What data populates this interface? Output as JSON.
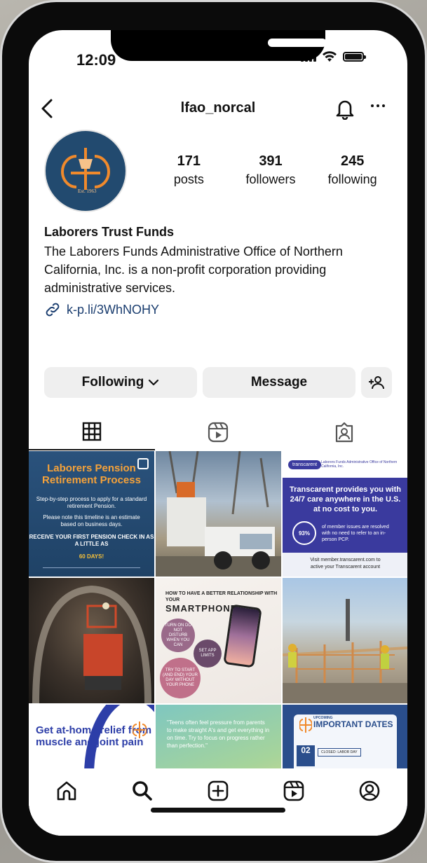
{
  "status_bar": {
    "time": "12:09"
  },
  "header": {
    "username": "lfao_norcal"
  },
  "profile": {
    "avatar_est": "Est. 1963",
    "stats": [
      {
        "value": "171",
        "label": "posts"
      },
      {
        "value": "391",
        "label": "followers"
      },
      {
        "value": "245",
        "label": "following"
      }
    ],
    "name": "Laborers Trust Funds",
    "bio": "The Laborers Funds Administrative Office of Northern California, Inc. is a non-profit corporation providing administrative services.",
    "link": "k-p.li/3WhNOHY"
  },
  "actions": {
    "following_label": "Following",
    "message_label": "Message"
  },
  "tabs": [
    "posts-grid",
    "reels",
    "tagged"
  ],
  "posts": {
    "p1": {
      "title": "Laborers Pension Retirement Process",
      "line1": "Step-by-step process to apply for a standard retirement Pension.",
      "line2": "Please note this timeline is an estimate based on business days.",
      "line3": "RECEIVE YOUR FIRST PENSION CHECK IN AS A LITTLE AS",
      "line3b": "60 DAYS!"
    },
    "p3": {
      "pill": "transcarent",
      "logo": "Laborers Funds Administrative Office of Northern California, Inc.",
      "headline": "Transcarent provides you with 24/7 care anywhere in the U.S. at no cost to you.",
      "percent": "93%",
      "stat_text": "of member issues are resolved with no need to refer to an in-person PCP.",
      "footer1": "Visit member.transcarent.com to",
      "footer2": "active your Transcarent account"
    },
    "p5": {
      "h1": "HOW TO HAVE A BETTER RELATIONSHIP WITH YOUR",
      "h2": "SMARTPHONE",
      "b1": "TURN ON DO NOT DISTURB WHEN YOU CAN",
      "b2": "SET APP LIMITS",
      "b3": "TRY TO START (AND END) YOUR DAY WITHOUT YOUR PHONE"
    },
    "p7": {
      "text": "Get at-home relief from muscle and joint pain"
    },
    "p8": {
      "text": "\"Teens often feel pressure from parents to make straight A's and get everything in on time. Try to focus on progress rather than perfection.\""
    },
    "p9": {
      "upcoming": "UPCOMING",
      "title": "IMPORTANT DATES",
      "day": "02",
      "closed": "CLOSED: LABOR DAY"
    }
  },
  "bottom_nav": [
    "home",
    "search",
    "create",
    "reels",
    "profile"
  ],
  "colors": {
    "brand_navy": "#224a6f",
    "brand_orange": "#f08a2c",
    "link": "#1a3d6f"
  }
}
